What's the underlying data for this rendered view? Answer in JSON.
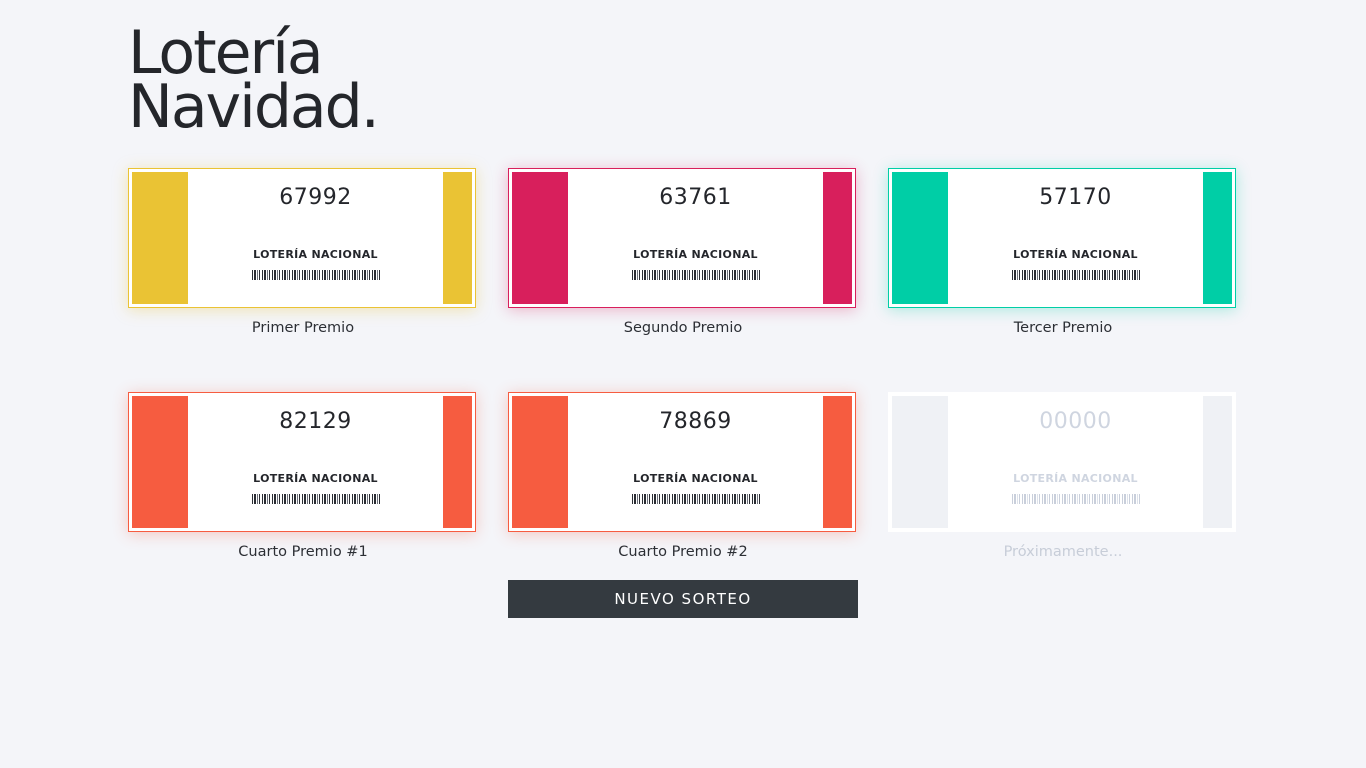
{
  "header": {
    "title_line1": "Lotería",
    "title_line2": "Navidad."
  },
  "prizes": [
    {
      "number": "67992",
      "issuer": "LOTERÍA NACIONAL",
      "label": "Primer Premio",
      "color": "#eac334",
      "glow": "rgba(234,195,52,0.35)"
    },
    {
      "number": "63761",
      "issuer": "LOTERÍA NACIONAL",
      "label": "Segundo Premio",
      "color": "#d81f5c",
      "glow": "rgba(216,31,92,0.30)"
    },
    {
      "number": "57170",
      "issuer": "LOTERÍA NACIONAL",
      "label": "Tercer Premio",
      "color": "#00cea6",
      "glow": "rgba(0,206,166,0.30)"
    },
    {
      "number": "82129",
      "issuer": "LOTERÍA NACIONAL",
      "label": "Cuarto Premio #1",
      "color": "#f65c40",
      "glow": "rgba(246,92,64,0.30)"
    },
    {
      "number": "78869",
      "issuer": "LOTERÍA NACIONAL",
      "label": "Cuarto Premio #2",
      "color": "#f65c40",
      "glow": "rgba(246,92,64,0.30)"
    },
    {
      "number": "00000",
      "issuer": "LOTERÍA NACIONAL",
      "label": "Próximamente...",
      "color": "#eff1f5",
      "glow": "rgba(0,0,0,0)"
    }
  ],
  "actions": {
    "new_draw_label": "NUEVO SORTEO"
  }
}
